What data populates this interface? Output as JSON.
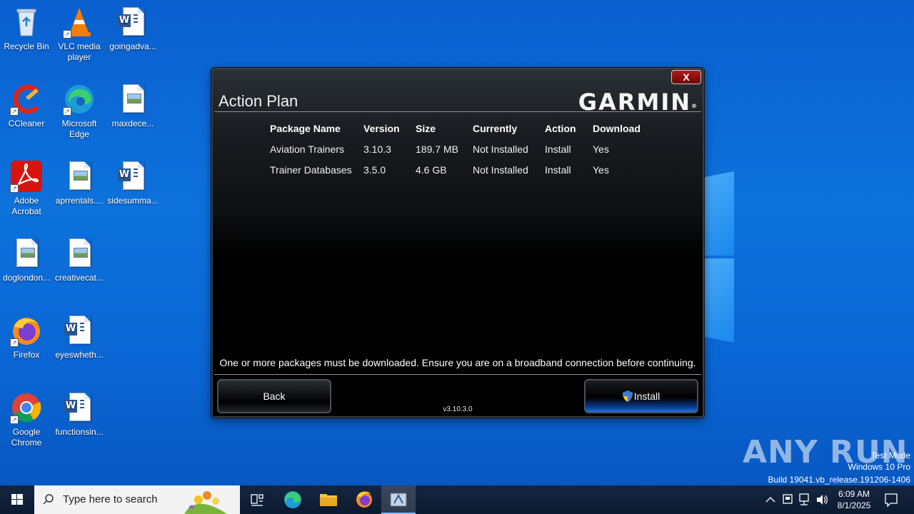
{
  "desktop": {
    "icons": [
      {
        "label": "Recycle Bin"
      },
      {
        "label": "VLC media player"
      },
      {
        "label": "goingadva..."
      },
      {
        "label": "CCleaner"
      },
      {
        "label": "Microsoft Edge"
      },
      {
        "label": "maxdece..."
      },
      {
        "label": "Adobe Acrobat"
      },
      {
        "label": "aprrentals...."
      },
      {
        "label": "sidesumma..."
      },
      {
        "label": "doglondon..."
      },
      {
        "label": "creativecat..."
      },
      {
        "label": "Firefox"
      },
      {
        "label": "eyeswheth..."
      },
      {
        "label": "Google Chrome"
      },
      {
        "label": "functionsin..."
      }
    ]
  },
  "dialog": {
    "title": "Action Plan",
    "close_label": "X",
    "brand": "GARMIN",
    "brand_mark": "®",
    "table": {
      "headers": [
        "Package Name",
        "Version",
        "Size",
        "Currently",
        "Action",
        "Download"
      ],
      "rows": [
        [
          "Aviation Trainers",
          "3.10.3",
          "189.7 MB",
          "Not Installed",
          "Install",
          "Yes"
        ],
        [
          "Trainer Databases",
          "3.5.0",
          "4.6 GB",
          "Not Installed",
          "Install",
          "Yes"
        ]
      ]
    },
    "notice": "One or more packages must be downloaded. Ensure you are on a broadband connection before continuing.",
    "back_label": "Back",
    "install_label": "Install",
    "version": "v3.10.3.0"
  },
  "watermark": {
    "brand": "ANY RUN",
    "mode": "Test Mode",
    "edition": "Windows 10 Pro",
    "build": "Build 19041.vb_release.191206-1406"
  },
  "taskbar": {
    "search_placeholder": "Type here to search",
    "time": "6:09 AM",
    "date": "8/1/2025"
  },
  "colors": {
    "desktop_blue": "#0a66d4",
    "dialog_bg": "#000000",
    "close_red": "#b11a1a",
    "install_glow": "#1b73e6"
  }
}
